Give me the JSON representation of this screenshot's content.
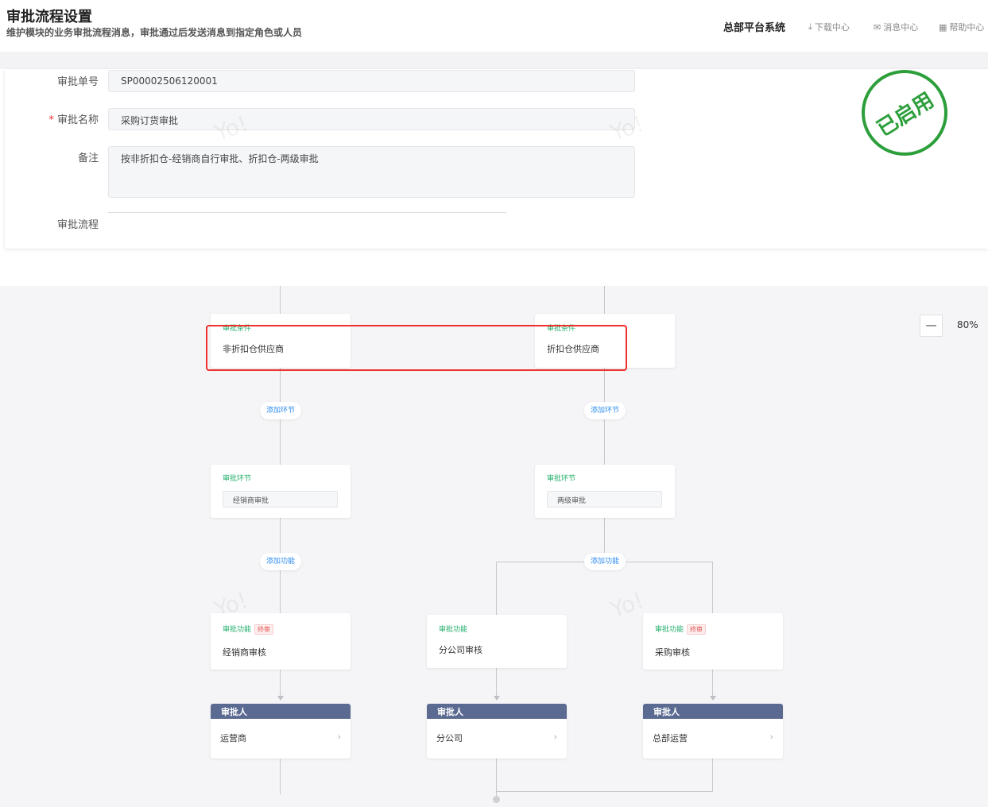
{
  "header": {
    "title": "审批流程设置",
    "subtitle": "维护模块的业务审批流程消息，审批通过后发送消息到指定角色或人员",
    "system": "总部平台系统",
    "links": [
      "下载中心",
      "消息中心",
      "帮助中心"
    ]
  },
  "form": {
    "order_no_label": "审批单号",
    "order_no": "SP00002506120001",
    "name_label": "审批名称",
    "name": "采购订货审批",
    "remark_label": "备注",
    "remark": "按非折扣仓-经销商自行审批、折扣仓-两级审批",
    "flow_label": "审批流程",
    "status_stamp": "已启用"
  },
  "flow": {
    "zoom": "80%",
    "zoom_out": "—",
    "condition_tag": "审批条件",
    "step_tag": "审批环节",
    "func_tag": "审批功能",
    "final_tag": "终审",
    "add_step": "添加环节",
    "add_func": "添加功能",
    "approver_label": "审批人",
    "conditions": [
      "非折扣仓供应商",
      "折扣仓供应商"
    ],
    "steps": [
      "经销商审批",
      "两级审批"
    ],
    "functions": [
      "经销商审核",
      "分公司审核",
      "采购审核"
    ],
    "approvers": [
      "运营商",
      "分公司",
      "总部运营"
    ]
  },
  "colors": {
    "accent": "#2d8cf0",
    "green": "#1fae6a",
    "approver_header": "#5a6a91",
    "highlight": "#f0302a"
  }
}
